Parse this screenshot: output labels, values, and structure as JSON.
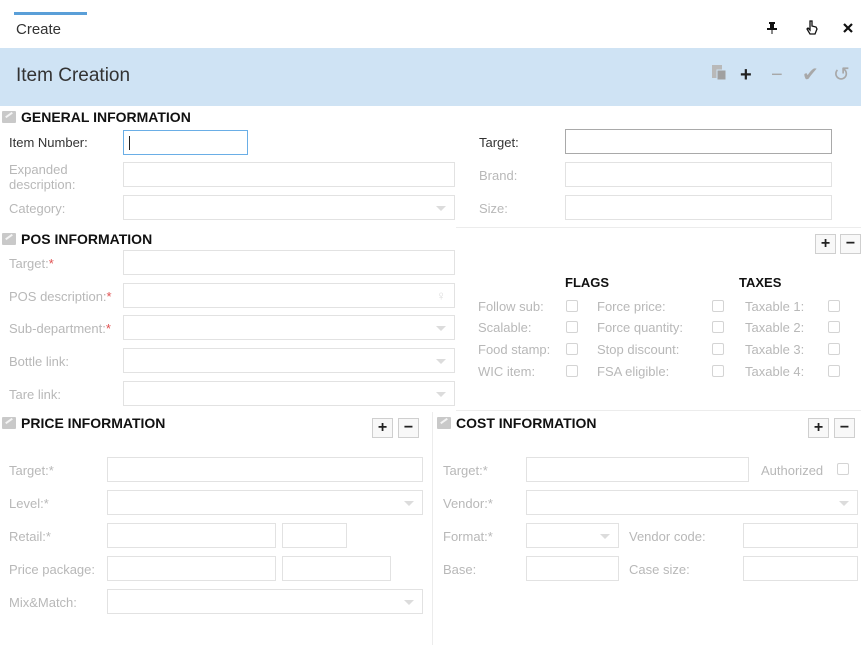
{
  "tab": {
    "label": "Create"
  },
  "window_icons": {
    "pin": "pin-icon",
    "pointer": "pointer-icon",
    "close": "close-icon"
  },
  "header": {
    "title": "Item Creation",
    "toolbar": [
      "paste-icon",
      "plus-icon",
      "minus-icon",
      "check-icon",
      "undo-icon"
    ]
  },
  "colors": {
    "header_bg": "#cfe3f4",
    "accent": "#5a9fd8",
    "required": "#e05050"
  },
  "general": {
    "title": "GENERAL INFORMATION",
    "item_number_label": "Item Number:",
    "item_number_value": "",
    "expanded_description_label_1": "Expanded",
    "expanded_description_label_2": "description:",
    "category_label": "Category:",
    "target_label": "Target:",
    "brand_label": "Brand:",
    "size_label": "Size:"
  },
  "pos": {
    "title": "POS INFORMATION",
    "target_label": "Target:",
    "pos_description_label": "POS description:",
    "sub_department_label": "Sub-department:",
    "bottle_link_label": "Bottle link:",
    "tare_link_label": "Tare link:",
    "required_mark": "*",
    "flags_header": "FLAGS",
    "taxes_header": "TAXES",
    "flags_col1": [
      "Follow sub:",
      "Scalable:",
      "Food stamp:",
      "WIC item:"
    ],
    "flags_col2": [
      "Force price:",
      "Force quantity:",
      "Stop discount:",
      "FSA eligible:"
    ],
    "taxes": [
      "Taxable 1:",
      "Taxable 2:",
      "Taxable 3:",
      "Taxable 4:"
    ]
  },
  "price": {
    "title": "PRICE INFORMATION",
    "target_label": "Target:*",
    "level_label": "Level:*",
    "retail_label": "Retail:*",
    "price_package_label": "Price package:",
    "mix_match_label": "Mix&Match:"
  },
  "cost": {
    "title": "COST INFORMATION",
    "target_label": "Target:*",
    "authorized_label": "Authorized",
    "vendor_label": "Vendor:*",
    "format_label": "Format:*",
    "vendor_code_label": "Vendor code:",
    "base_label": "Base:",
    "case_size_label": "Case size:"
  },
  "buttons": {
    "plus": "+",
    "minus": "−"
  }
}
